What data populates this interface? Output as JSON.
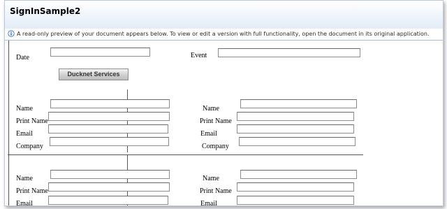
{
  "window": {
    "title": "SignInSample2"
  },
  "info_bar": {
    "icon": "info-icon",
    "text": "A read-only preview of your document appears below. To view or edit a version with full functionality, open the document in its original application."
  },
  "form": {
    "date_label": "Date",
    "event_label": "Event",
    "button_label": "Ducknet Services",
    "name_label": "Name",
    "print_name_label": "Print Name",
    "email_label": "Email",
    "company_label": "Company"
  }
}
